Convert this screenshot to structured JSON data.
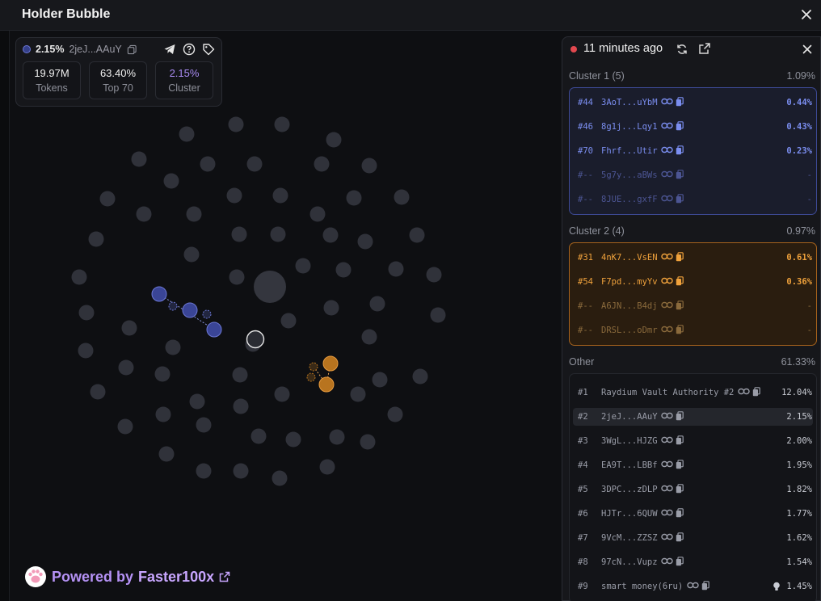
{
  "app": {
    "title": "Holder Bubble"
  },
  "summary": {
    "percent": "2.15%",
    "address": "2jeJ...AAuY",
    "stats": [
      {
        "value": "19.97M",
        "label": "Tokens",
        "color": "#f0f0f0"
      },
      {
        "value": "63.40%",
        "label": "Top 70",
        "color": "#f0f0f0"
      },
      {
        "value": "2.15%",
        "label": "Cluster",
        "color": "#a98bf2"
      }
    ]
  },
  "powered": {
    "prefix": "Powered by",
    "brand": "Faster100x"
  },
  "panel": {
    "updated": "11 minutes ago",
    "cluster1": {
      "label": "Cluster 1 (5)",
      "pct": "1.09%",
      "rows": [
        {
          "rank": "#44",
          "addr": "3AoT...uYbM",
          "pct": "0.44%",
          "dim": false
        },
        {
          "rank": "#46",
          "addr": "8g1j...Lqy1",
          "pct": "0.43%",
          "dim": false
        },
        {
          "rank": "#70",
          "addr": "Fhrf...Utir",
          "pct": "0.23%",
          "dim": false
        },
        {
          "rank": "#--",
          "addr": "5g7y...aBWs",
          "pct": "-",
          "dim": true
        },
        {
          "rank": "#--",
          "addr": "8JUE...gxfF",
          "pct": "-",
          "dim": true
        }
      ]
    },
    "cluster2": {
      "label": "Cluster 2 (4)",
      "pct": "0.97%",
      "rows": [
        {
          "rank": "#31",
          "addr": "4nK7...VsEN",
          "pct": "0.61%",
          "dim": false
        },
        {
          "rank": "#54",
          "addr": "F7pd...myYv",
          "pct": "0.36%",
          "dim": false
        },
        {
          "rank": "#--",
          "addr": "A6JN...B4dj",
          "pct": "-",
          "dim": true
        },
        {
          "rank": "#--",
          "addr": "DRSL...oDmr",
          "pct": "-",
          "dim": true
        }
      ]
    },
    "other": {
      "label": "Other",
      "pct": "61.33%",
      "rows": [
        {
          "rank": "#1",
          "addr": "Raydium Vault Authority #2",
          "pct": "12.04%"
        },
        {
          "rank": "#2",
          "addr": "2jeJ...AAuY",
          "pct": "2.15%",
          "highlight": true
        },
        {
          "rank": "#3",
          "addr": "3WgL...HJZG",
          "pct": "2.00%"
        },
        {
          "rank": "#4",
          "addr": "EA9T...LBBf",
          "pct": "1.95%"
        },
        {
          "rank": "#5",
          "addr": "3DPC...zDLP",
          "pct": "1.82%"
        },
        {
          "rank": "#6",
          "addr": "HJTr...6QUW",
          "pct": "1.77%"
        },
        {
          "rank": "#7",
          "addr": "9VcM...ZZSZ",
          "pct": "1.62%"
        },
        {
          "rank": "#8",
          "addr": "97cN...Vupz",
          "pct": "1.54%"
        },
        {
          "rank": "#9",
          "addr": "smart money(6ru)",
          "pct": "1.45%",
          "bulb": true
        }
      ]
    }
  }
}
